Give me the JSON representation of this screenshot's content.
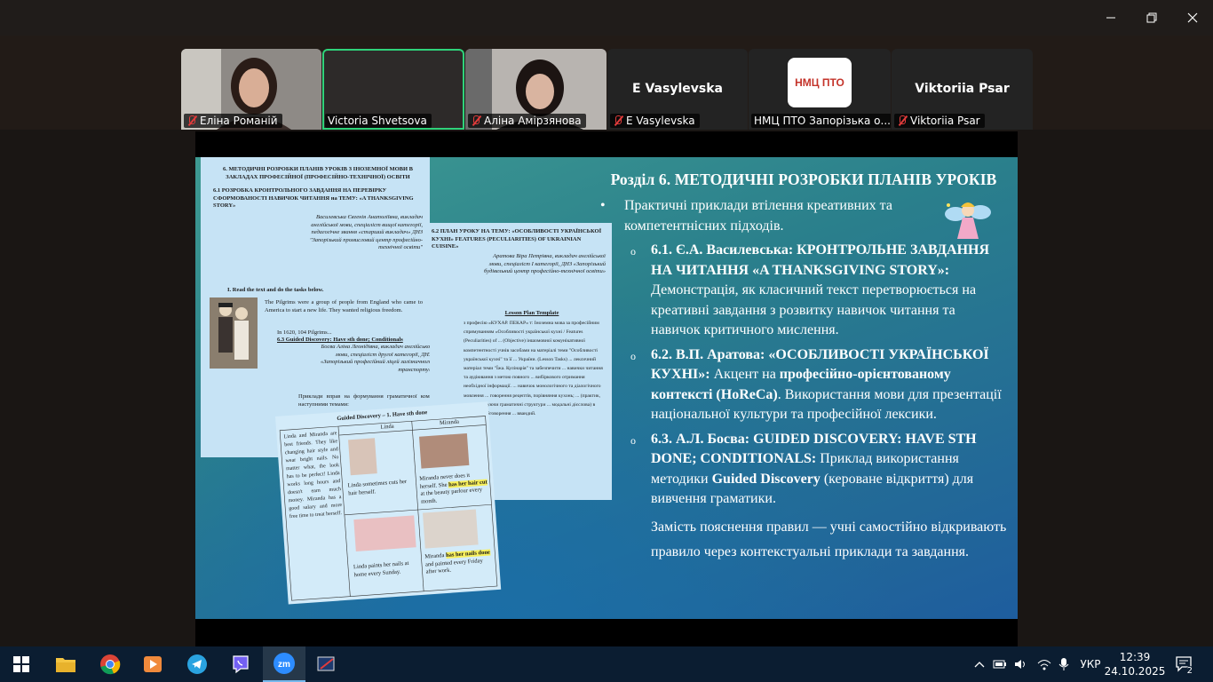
{
  "participants": [
    {
      "name": "Еліна Романій",
      "muted": true
    },
    {
      "name": "Victoria Shvetsova",
      "muted": false,
      "active": true
    },
    {
      "name": "Аліна Амірзянова",
      "muted": true
    },
    {
      "name": "E Vasylevska",
      "display": "E Vasylevska",
      "muted": true
    },
    {
      "name": "НМЦ ПТО Запорізька о...",
      "logo_text": "НМЦ ПТО",
      "muted": false
    },
    {
      "name": "Viktoriia Psar",
      "display": "Viktoriia Psar",
      "muted": true
    }
  ],
  "slide": {
    "title": "Розділ 6. МЕТОДИЧНІ РОЗРОБКИ ПЛАНІВ УРОКІВ",
    "intro": "Практичні приклади втілення креативних та компетентнісних підходів.",
    "items": [
      {
        "head": "6.1. Є.А. Василевська: КРОНТРОЛЬНЕ ЗАВДАННЯ НА ЧИТАННЯ «A THANKSGIVING STORY»:",
        "text": " Демонстрація, як класичний текст перетворюється на креативні завдання з розвитку навичок читання та навичок критичного мислення."
      },
      {
        "head": "6.2. В.П. Аратова: «ОСОБЛИВОСТІ УКРАЇНСЬКОЇ КУХНІ»:",
        "text1": " Акцент на ",
        "bold2": "професійно-орієнтованому контексті (HoReCa)",
        "text2": ". Використання мови для презентації національної культури та професійної лексики."
      },
      {
        "head": "6.3. А.Л. Босва: GUIDED DISCOVERY: HAVE STH DONE; CONDITIONALS:",
        "text1": " Приклад використання методики ",
        "bold2": "Guided Discovery",
        "text2": " (кероване відкриття) для вивчення граматики."
      }
    ],
    "closing": "Замість пояснення правил — учні самостійно відкривають правило через контекстуальні приклади та завдання."
  },
  "docs": {
    "a_heading": "6. МЕТОДИЧНІ РОЗРОБКИ ПЛАНІВ УРОКІВ З ІНОЗЕМНОЇ МОВИ В ЗАКЛАДАХ ПРОФЕСІЙНОЇ (ПРОФЕСІЙНО-ТЕХНІЧНОЇ) ОСВІТИ",
    "a_sub": "6.1 РОЗРОБКА КРОНТРОЛЬНОГО ЗАВДАННЯ НА ПЕРЕВІРКУ СФОРМОВАНОСТІ НАВИЧОК ЧИТАННЯ на ТЕМУ: «A THANKSGIVING STORY»",
    "a_author": "Василевська Євгенія Анатоліївна, викладач англійської мови, спеціаліст вищої категорії, педагогічне звання «старший викладач» ДНЗ \"Запорізький промисловий центр професійно-технічної освіти\"",
    "a_task": "I.      Read the text and do the tasks below.",
    "a_text": "The Pilgrims were a group of people from England who came to America to start a new life. They wanted religious freedom.",
    "a_year": "In 1620, 104 Pilgrims...",
    "a_63": "6.3 Guided Discovery: Have sth done; Conditionals",
    "a_author3": "Босва Аліна Леонідівна, викладач англійської мови, спеціаліст другої категорії, ДНЗ «Запорізький професійний ліцей залізничного транспорту»",
    "a_example": "Приклади вправ на формування граматичної компетенції за наступними темами:",
    "b_heading": "6.2 ПЛАН УРОКУ НА ТЕМУ: «ОСОБЛИВОСТІ УКРАЇНСЬКОЇ КУХНІ» FEATURES (PECULIARITIES) OF UKRAINIAN CUISINE»",
    "b_author": "Аратова Віра Петрівна, викладач англійської мови, спеціаліст І категорії, ДНЗ «Запорізький будівельний центр професійно-технічної освіти»",
    "b_plan": "Lesson Plan Template",
    "b_lines": "з професію «КУХАР. ПЕКАР» т: Іноземна мова за професійним спрямуванням «Особливості української кухні / Features (Peculiarities) of ... (Objective) іншомовної комунікативної компетентності учнів засобами на матеріалі теми \"Особливості української кухні\" та її ... України. (Lesson Tasks) ... лексичний матеріал теми \"Їжа. Кулінарія\" та забезпечити ... навички читання та аудіювання з метою повного ... вибіркового отримання необхідної інформації. ... навичок монологічного та діалогічного мовлення ... говорення рецептів, порівняння кухонь; ... (практик, використовуючи граматичні структури ... модальні дієслова) в контексті обговорення ... ввандий.",
    "c_title": "Guided Discovery – 1. Have sth done",
    "c_col1": "Linda",
    "c_col2": "Miranda",
    "c_story": "Linda and Miranda are best friends. They like changing hair style and wear bright nails. No matter what, the look has to be perfect! Linda works long hours and doesn't earn much money. Miranda has a good salary and more free time to treat herself.",
    "c_l1": "Linda sometimes cuts her hair herself.",
    "c_m1a": "Miranda never does it herself. She ",
    "c_m1b": "has her hair cut",
    "c_m1c": " at the beauty parlour every month.",
    "c_l2": "Linda paints her nails at home every Sunday.",
    "c_m2a": "Miranda ",
    "c_m2b": "has her nails done",
    "c_m2c": " and painted every Friday after work."
  },
  "taskbar": {
    "language": "УКР",
    "time": "12:39",
    "date": "24.10.2025",
    "notifications": "2"
  },
  "colors": {
    "active_speaker": "#2fd27a",
    "muted": "#e23b3b",
    "taskbar": "#0b1d31"
  }
}
